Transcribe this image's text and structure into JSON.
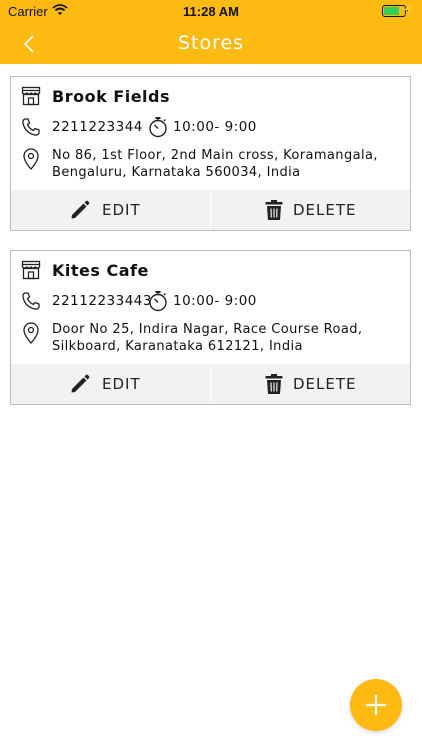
{
  "status_bar": {
    "carrier": "Carrier",
    "time": "11:28 AM",
    "battery_level": 0.8
  },
  "header": {
    "title": "Stores"
  },
  "colors": {
    "accent": "#FDBA12",
    "action_bg": "#f2f2f2",
    "border": "#bdbdbd"
  },
  "stores": [
    {
      "name": "Brook Fields",
      "phone": "2211223344",
      "hours": "10:00- 9:00",
      "address": "No 86, 1st Floor, 2nd Main cross, Koramangala, Bengaluru, Karnataka 560034, India",
      "edit_label": "EDIT",
      "delete_label": "DELETE"
    },
    {
      "name": "Kites Cafe",
      "phone": "22112233443",
      "hours": "10:00- 9:00",
      "address": "Door No 25, Indira Nagar, Race Course Road, Silkboard, Karanataka 612121, India",
      "edit_label": "EDIT",
      "delete_label": "DELETE"
    }
  ],
  "icons": [
    "back-icon",
    "store-icon",
    "phone-icon",
    "stopwatch-icon",
    "location-pin-icon",
    "pencil-icon",
    "trash-icon",
    "plus-icon"
  ]
}
